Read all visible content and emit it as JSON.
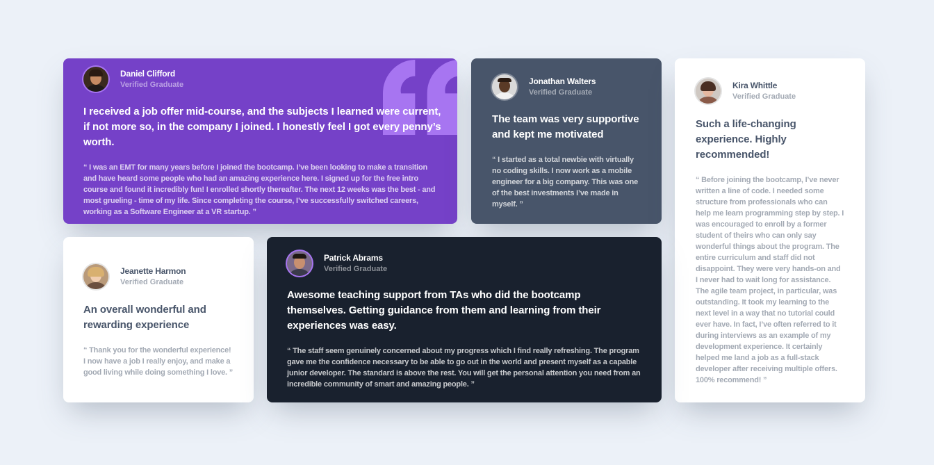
{
  "testimonials": [
    {
      "name": "Daniel Clifford",
      "role": "Verified Graduate",
      "headline": "I received a job offer mid-course, and the subjects I learned were current, if not more so, in the company I joined. I honestly feel I got every penny’s worth.",
      "quote": "“ I was an EMT for many years before I joined the bootcamp. I’ve been looking to make a transition and have heard some people who had an amazing experience here. I signed up for the free intro course and found it incredibly fun! I enrolled shortly thereafter. The next 12 weeks was the best - and most grueling - time of my life. Since completing the course, I’ve successfully switched careers, working as a Software Engineer at a VR startup. ”"
    },
    {
      "name": "Jonathan Walters",
      "role": "Verified Graduate",
      "headline": "The team was very supportive and kept me motivated",
      "quote": "“ I started as a total newbie with virtually no coding skills. I now work as a mobile engineer for a big company. This was one of the best investments I’ve made in myself. ”"
    },
    {
      "name": "Kira Whittle",
      "role": "Verified Graduate",
      "headline": "Such a life-changing experience. Highly recommended!",
      "quote": "“ Before joining the bootcamp, I’ve never written a line of code. I needed some structure from professionals who can help me learn programming step by step. I was encouraged to enroll by a former student of theirs who can only say wonderful things about the program. The entire curriculum and staff did not disappoint. They were very hands-on and I never had to wait long for assistance. The agile team project, in particular, was outstanding. It took my learning to the next level in a way that no tutorial could ever have. In fact, I’ve often referred to it during interviews as an example of my development experience. It certainly helped me land a job as a full-stack developer after receiving multiple offers. 100% recommend! ”"
    },
    {
      "name": "Jeanette Harmon",
      "role": "Verified Graduate",
      "headline": "An overall wonderful and rewarding experience",
      "quote": "“ Thank you for the wonderful experience! I now have a job I really enjoy, and make a good living while doing something I love. ”"
    },
    {
      "name": "Patrick Abrams",
      "role": "Verified Graduate",
      "headline": "Awesome teaching support from TAs who did the bootcamp themselves. Getting guidance from them and learning from their experiences was easy.",
      "quote": "“ The staff seem genuinely concerned about my progress which I find really refreshing. The program gave me the confidence necessary to be able to go out in the world and present myself as a capable junior developer. The standard is above the rest. You will get the personal attention you need from an incredible community of smart and amazing people. ”"
    }
  ],
  "icons": {
    "quote": "quotation-mark-icon",
    "avatar": "avatar-photo"
  },
  "colors": {
    "background": "#ECF1F8",
    "purple": "#7541C8",
    "slate": "#48556A",
    "dark": "#19212E",
    "white": "#FFFFFF",
    "quote_accent": "#A775F1"
  }
}
